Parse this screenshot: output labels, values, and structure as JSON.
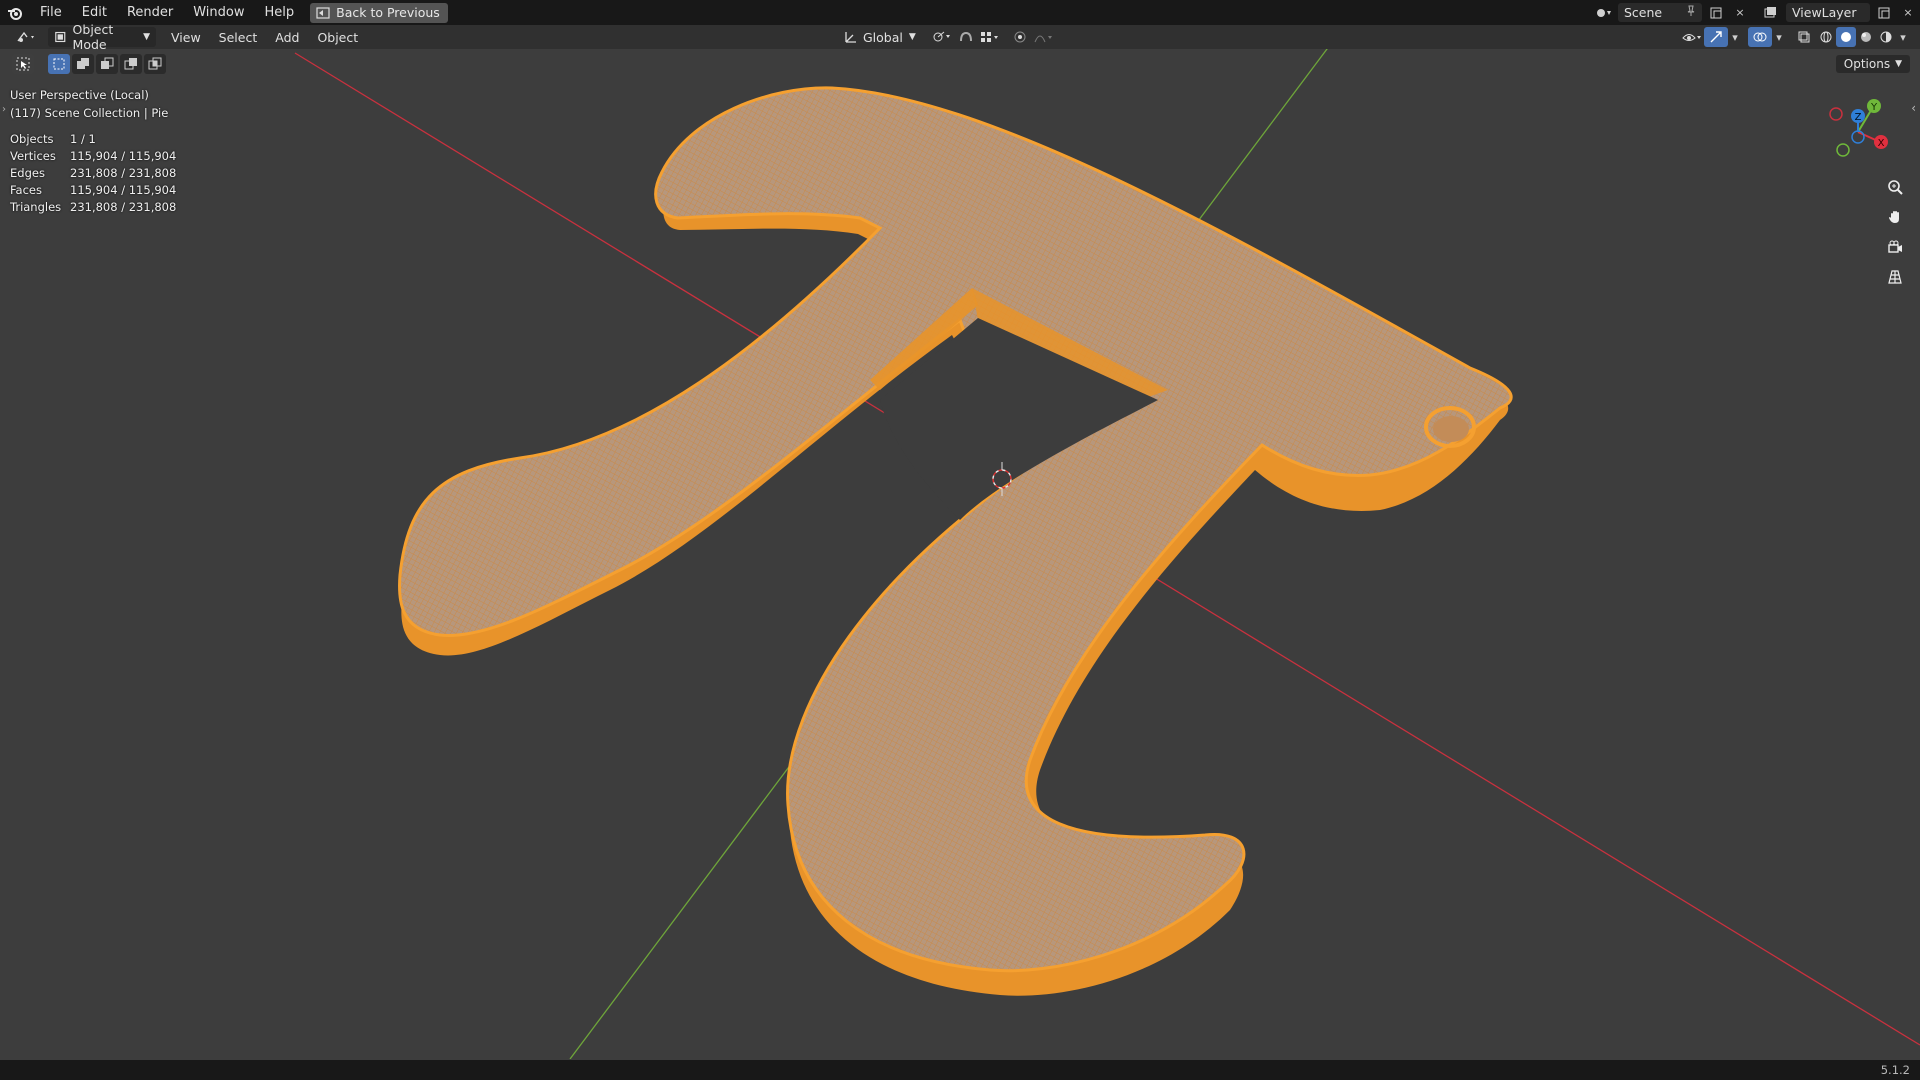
{
  "topbar": {
    "menus": [
      "File",
      "Edit",
      "Render",
      "Window",
      "Help"
    ],
    "back_label": "Back to Previous",
    "scene": "Scene",
    "view_layer": "ViewLayer"
  },
  "header": {
    "mode": "Object Mode",
    "menus": [
      "View",
      "Select",
      "Add",
      "Object"
    ],
    "orientation": "Global",
    "options": "Options"
  },
  "viewport": {
    "perspective": "User Perspective (Local)",
    "collection": "(117) Scene Collection | Pie",
    "stats": [
      {
        "label": "Objects",
        "value": "1 / 1"
      },
      {
        "label": "Vertices",
        "value": "115,904 / 115,904"
      },
      {
        "label": "Edges",
        "value": "231,808 / 231,808"
      },
      {
        "label": "Faces",
        "value": "115,904 / 115,904"
      },
      {
        "label": "Triangles",
        "value": "231,808 / 231,808"
      }
    ],
    "gizmo_axes": {
      "x": "X",
      "y": "Y",
      "z": "Z"
    },
    "colors": {
      "mesh": "#f5a030",
      "wire": "#c98a4a",
      "x_axis": "#e0303f",
      "y_axis": "#6fb83a",
      "z_axis": "#2f7fd8",
      "background": "#3d3d3d"
    }
  },
  "status": {
    "version": "5.1.2"
  }
}
